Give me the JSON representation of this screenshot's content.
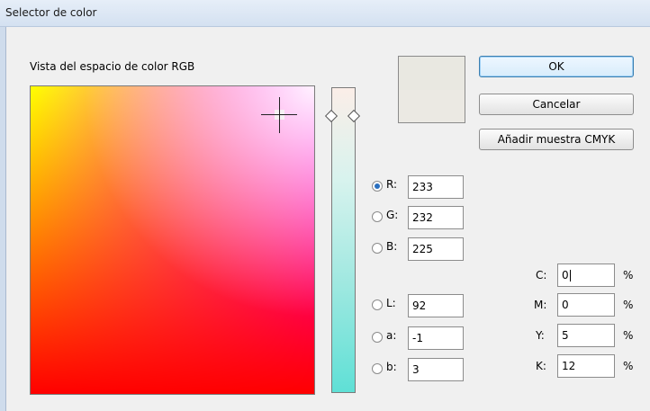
{
  "window": {
    "title": "Selector de color"
  },
  "section_label": "Vista del espacio de color RGB",
  "buttons": {
    "ok": "OK",
    "cancel": "Cancelar",
    "add_swatch": "Añadir muestra CMYK"
  },
  "swatch": {
    "new_color": "#e9e8e1",
    "original_color": "#ebe9e3"
  },
  "rgb": {
    "selected": "R",
    "fields": [
      {
        "label": "R:",
        "value": "233"
      },
      {
        "label": "G:",
        "value": "232"
      },
      {
        "label": "B:",
        "value": "225"
      }
    ]
  },
  "lab": {
    "fields": [
      {
        "label": "L:",
        "value": "92"
      },
      {
        "label": "a:",
        "value": "-1"
      },
      {
        "label": "b:",
        "value": "3"
      }
    ]
  },
  "cmyk": {
    "unit": "%",
    "fields": [
      {
        "label": "C:",
        "value": "0"
      },
      {
        "label": "M:",
        "value": "0"
      },
      {
        "label": "Y:",
        "value": "5"
      },
      {
        "label": "K:",
        "value": "12"
      }
    ]
  }
}
